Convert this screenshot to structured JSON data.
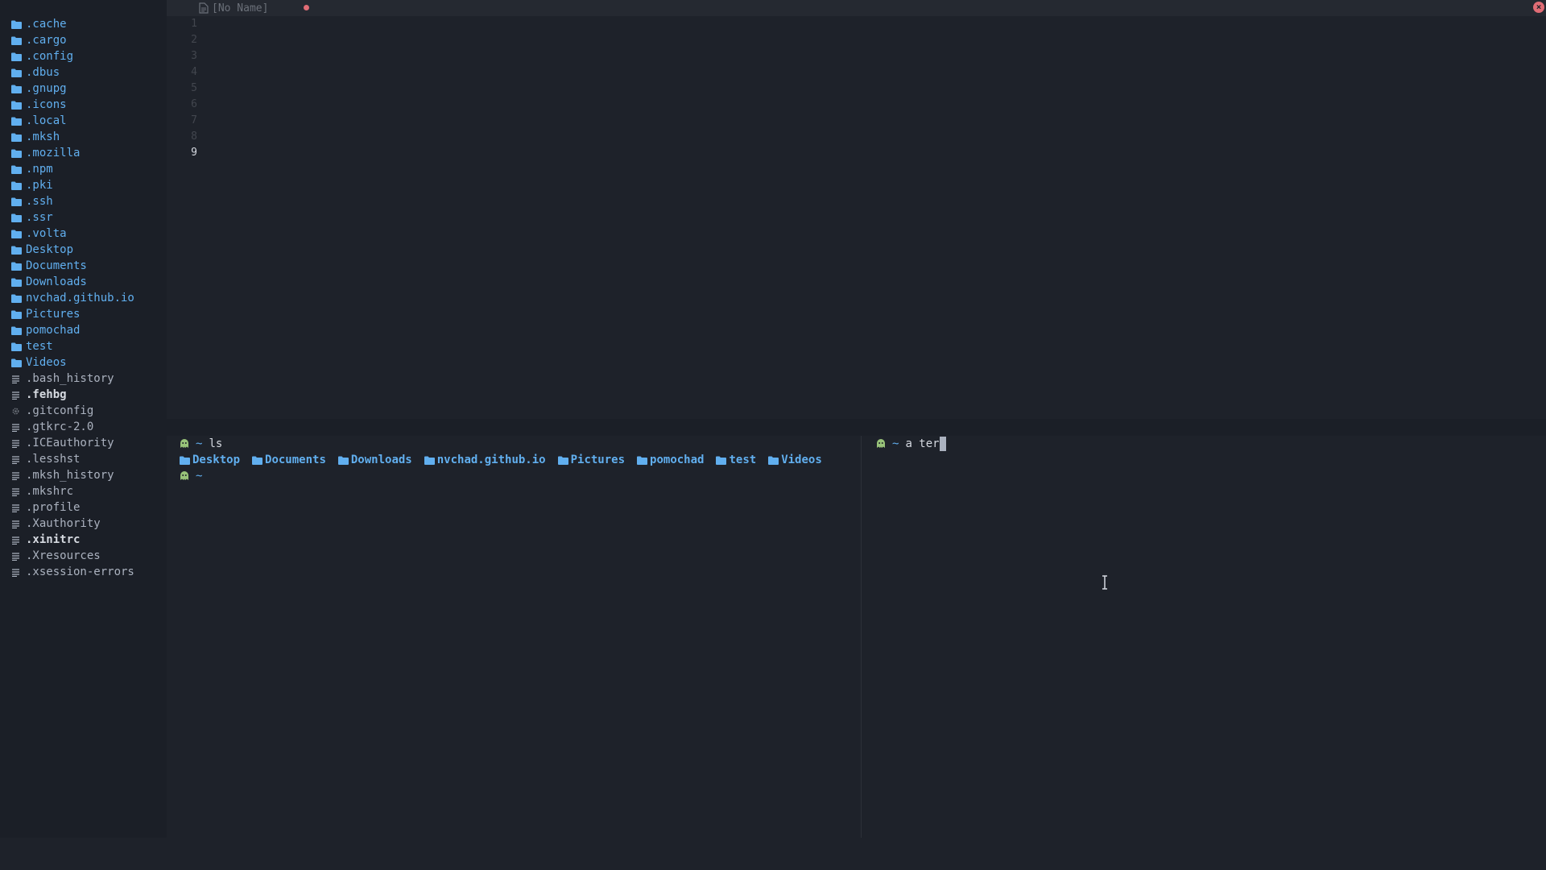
{
  "colors": {
    "background": "#1e222a",
    "sidebar_background": "#1b1f27",
    "folder_blue": "#61afef",
    "text": "#abb2bf",
    "line_number": "#42464e",
    "modified_dot": "#e06c75",
    "ghost_green": "#98c379"
  },
  "sidebar": {
    "items": [
      {
        "name": ".cache",
        "type": "folder",
        "icon": "folder-icon"
      },
      {
        "name": ".cargo",
        "type": "folder",
        "icon": "folder-icon"
      },
      {
        "name": ".config",
        "type": "folder",
        "icon": "folder-icon"
      },
      {
        "name": ".dbus",
        "type": "folder",
        "icon": "folder-icon"
      },
      {
        "name": ".gnupg",
        "type": "folder",
        "icon": "folder-icon"
      },
      {
        "name": ".icons",
        "type": "folder",
        "icon": "folder-icon"
      },
      {
        "name": ".local",
        "type": "folder",
        "icon": "folder-icon"
      },
      {
        "name": ".mksh",
        "type": "folder",
        "icon": "folder-icon"
      },
      {
        "name": ".mozilla",
        "type": "folder",
        "icon": "folder-icon"
      },
      {
        "name": ".npm",
        "type": "folder",
        "icon": "folder-icon"
      },
      {
        "name": ".pki",
        "type": "folder",
        "icon": "folder-icon"
      },
      {
        "name": ".ssh",
        "type": "folder",
        "icon": "folder-icon"
      },
      {
        "name": ".ssr",
        "type": "folder",
        "icon": "folder-icon"
      },
      {
        "name": ".volta",
        "type": "folder",
        "icon": "folder-icon"
      },
      {
        "name": "Desktop",
        "type": "folder",
        "icon": "folder-icon"
      },
      {
        "name": "Documents",
        "type": "folder",
        "icon": "folder-icon"
      },
      {
        "name": "Downloads",
        "type": "folder",
        "icon": "folder-icon"
      },
      {
        "name": "nvchad.github.io",
        "type": "folder",
        "icon": "folder-icon"
      },
      {
        "name": "Pictures",
        "type": "folder",
        "icon": "folder-icon"
      },
      {
        "name": "pomochad",
        "type": "folder",
        "icon": "folder-icon"
      },
      {
        "name": "test",
        "type": "folder",
        "icon": "folder-icon"
      },
      {
        "name": "Videos",
        "type": "folder",
        "icon": "folder-icon"
      },
      {
        "name": ".bash_history",
        "type": "file",
        "icon": "text-file-icon"
      },
      {
        "name": ".fehbg",
        "type": "file",
        "icon": "text-file-icon",
        "bold": true
      },
      {
        "name": ".gitconfig",
        "type": "file",
        "icon": "gear-icon"
      },
      {
        "name": ".gtkrc-2.0",
        "type": "file",
        "icon": "text-file-icon"
      },
      {
        "name": ".ICEauthority",
        "type": "file",
        "icon": "text-file-icon"
      },
      {
        "name": ".lesshst",
        "type": "file",
        "icon": "text-file-icon"
      },
      {
        "name": ".mksh_history",
        "type": "file",
        "icon": "text-file-icon"
      },
      {
        "name": ".mkshrc",
        "type": "file",
        "icon": "text-file-icon"
      },
      {
        "name": ".profile",
        "type": "file",
        "icon": "text-file-icon"
      },
      {
        "name": ".Xauthority",
        "type": "file",
        "icon": "text-file-icon"
      },
      {
        "name": ".xinitrc",
        "type": "file",
        "icon": "text-file-icon",
        "bold": true
      },
      {
        "name": ".Xresources",
        "type": "file",
        "icon": "text-file-icon"
      },
      {
        "name": ".xsession-errors",
        "type": "file",
        "icon": "text-file-icon"
      }
    ]
  },
  "tabline": {
    "tab_label": "[No Name]",
    "modified": true,
    "close_icon": "close-icon",
    "close_glyph": "×"
  },
  "editor": {
    "line_numbers": [
      "1",
      "2",
      "3",
      "4",
      "5",
      "6",
      "7",
      "8",
      "9"
    ],
    "current_line": "9"
  },
  "terminal_left": {
    "prompt_symbol": "~",
    "command": "ls",
    "ls_output": [
      "Desktop",
      "Documents",
      "Downloads",
      "nvchad.github.io",
      "Pictures",
      "pomochad",
      "test",
      "Videos"
    ],
    "second_prompt_symbol": "~"
  },
  "terminal_right": {
    "prompt_symbol": "~",
    "typed_text": "a ter"
  }
}
